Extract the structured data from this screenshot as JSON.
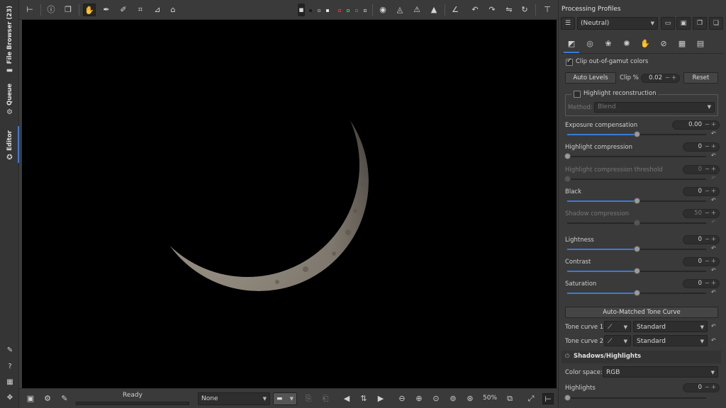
{
  "left_tabs": {
    "file_browser": "File Browser (23)",
    "queue": "Queue",
    "editor": "Editor"
  },
  "top_toolbar": {
    "icons": [
      "panel-toggle-icon",
      "info-icon",
      "before-after-icon",
      "hand-icon",
      "color-picker-icon",
      "white-balance-icon",
      "crop-icon",
      "straighten-icon",
      "perspective-icon",
      "preview-background-icon",
      "channel-red",
      "channel-green",
      "channel-blue",
      "channel-luminance",
      "focus-mask-icon",
      "shadow-clip-icon",
      "highlight-clip-icon",
      "warning-icon",
      "histogram-icon",
      "rotate-left-icon",
      "rotate-right-icon",
      "flip-h-icon",
      "flip-v-icon",
      "panel-toggle-right-icon"
    ]
  },
  "bottom_bar": {
    "status": "Ready",
    "profile_combo": "None",
    "zoom": "50%"
  },
  "right_panel": {
    "processing_profiles_title": "Processing Profiles",
    "profile_selected": "(Neutral)",
    "clip_gamut_label": "Clip out-of-gamut colors",
    "auto_levels_label": "Auto Levels",
    "clip_label": "Clip %",
    "clip_value": "0.02",
    "reset_label": "Reset",
    "highlight_reconstruction_label": "Highlight reconstruction",
    "method_label": "Method:",
    "method_value": "Blend",
    "sliders": [
      {
        "label": "Exposure compensation",
        "value": "0.00",
        "fraction": 0.5,
        "enabled": true
      },
      {
        "label": "Highlight compression",
        "value": "0",
        "fraction": 0.0,
        "enabled": true
      },
      {
        "label": "Highlight compression threshold",
        "value": "0",
        "fraction": 0.0,
        "enabled": false
      },
      {
        "label": "Black",
        "value": "0",
        "fraction": 0.5,
        "enabled": true
      },
      {
        "label": "Shadow compression",
        "value": "50",
        "fraction": 0.5,
        "enabled": false
      },
      {
        "label": "Lightness",
        "value": "0",
        "fraction": 0.5,
        "enabled": true
      },
      {
        "label": "Contrast",
        "value": "0",
        "fraction": 0.5,
        "enabled": true
      },
      {
        "label": "Saturation",
        "value": "0",
        "fraction": 0.5,
        "enabled": true
      }
    ],
    "auto_tone_curve_label": "Auto-Matched Tone Curve",
    "tone_curve_1_label": "Tone curve 1:",
    "tone_curve_1_value": "Standard",
    "tone_curve_2_label": "Tone curve 2:",
    "tone_curve_2_value": "Standard",
    "shadows_highlights_title": "Shadows/Highlights",
    "color_space_label": "Color space:",
    "color_space_value": "RGB",
    "highlights_label": "Highlights",
    "highlights_value": "0",
    "highlights_fraction": 0.0
  },
  "colors": {
    "accent": "#3a7bd5",
    "panel": "#3a3a3a",
    "canvas": "#000000"
  }
}
